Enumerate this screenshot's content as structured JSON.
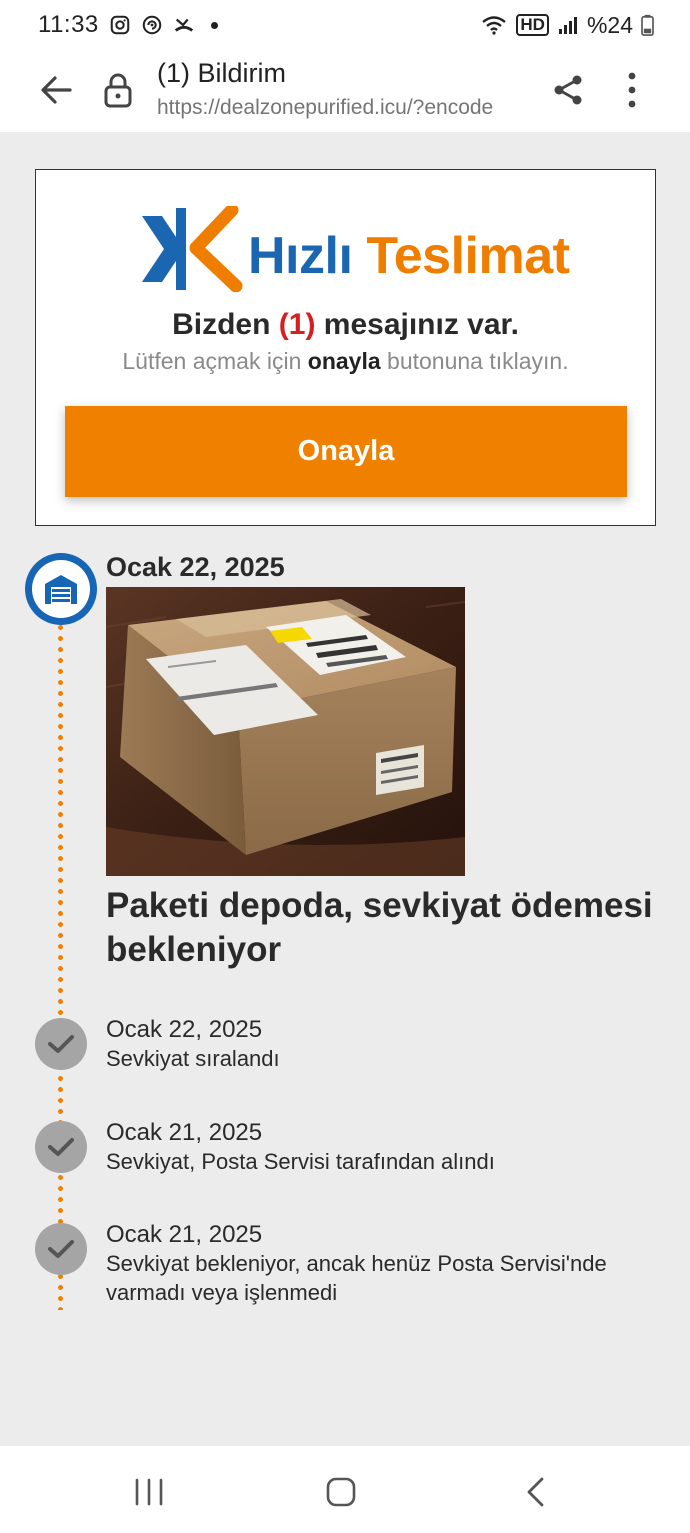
{
  "status_bar": {
    "time": "11:33",
    "network_label": "HD",
    "battery_percent": "%24",
    "icons": [
      "instagram-icon",
      "sync-icon",
      "missed-call-icon",
      "notification-dot",
      "wifi-icon",
      "hd-voice-icon",
      "signal-icon",
      "battery-icon"
    ]
  },
  "browser": {
    "tab_title": "(1) Bildirim",
    "url": "https://dealzonepurified.icu/?encode"
  },
  "notice": {
    "brand_part1": "Hızlı",
    "brand_part2": "Teslimat",
    "headline_before": "Bizden",
    "headline_count": "(1)",
    "headline_after": "mesajınız var.",
    "subline_before": "Lütfen açmak için",
    "subline_bold": "onayla",
    "subline_after": "butonuna tıklayın.",
    "button_label": "Onayla"
  },
  "timeline": {
    "main_event": {
      "date": "Ocak 22, 2025",
      "status": "Paketi depoda, sevkiyat ödemesi bekleniyor"
    },
    "events": [
      {
        "date": "Ocak 22, 2025",
        "description": "Sevkiyat sıralandı"
      },
      {
        "date": "Ocak 21, 2025",
        "description": "Sevkiyat, Posta Servisi tarafından alındı"
      },
      {
        "date": "Ocak 21, 2025",
        "description": "Sevkiyat bekleniyor, ancak henüz Posta Servisi'nde varmadı veya işlenmedi"
      }
    ]
  },
  "colors": {
    "accent_orange": "#f08000",
    "brand_blue": "#1b66b1",
    "count_red": "#d42020",
    "page_bg": "#ececec"
  }
}
